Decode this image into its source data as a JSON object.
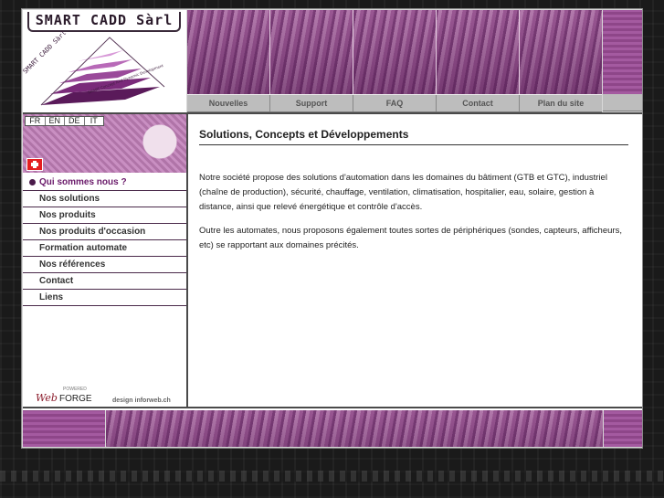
{
  "logo": {
    "title": "SMART CADD Sàrl",
    "arc_text": "SMART CADD Sàrl",
    "tagline": "SMART Concept And Dynamic Development"
  },
  "nav": {
    "items": [
      "Nouvelles",
      "Support",
      "FAQ",
      "Contact",
      "Plan du site"
    ]
  },
  "languages": [
    "FR",
    "EN",
    "DE",
    "IT"
  ],
  "menu": {
    "items": [
      {
        "label": "Qui sommes nous ?",
        "active": true
      },
      {
        "label": "Nos solutions",
        "active": false
      },
      {
        "label": "Nos produits",
        "active": false
      },
      {
        "label": "Nos produits d'occasion",
        "active": false
      },
      {
        "label": "Formation automate",
        "active": false
      },
      {
        "label": "Nos références",
        "active": false
      },
      {
        "label": "Contact",
        "active": false
      },
      {
        "label": "Liens",
        "active": false
      }
    ]
  },
  "powered": {
    "small": "POWERED",
    "web": "Web",
    "forge": "FORGE"
  },
  "design_credit": "design inforweb.ch",
  "main": {
    "title": "Solutions, Concepts et Développements",
    "paragraph1": "Notre société propose des solutions d'automation dans les domaines du bâtiment (GTB et GTC), industriel (chaîne de production), sécurité, chauffage, ventilation, climatisation, hospitalier, eau, solaire, gestion à distance, ainsi que relevé énergétique et contrôle d'accès.",
    "paragraph2": "Outre les automates, nous proposons également toutes sortes de périphériques (sondes, capteurs, afficheurs, etc) se rapportant aux domaines précités."
  },
  "colors": {
    "accent": "#b87cb1",
    "dark_line": "#4a4a4a",
    "active_menu": "#6a1a6a"
  }
}
